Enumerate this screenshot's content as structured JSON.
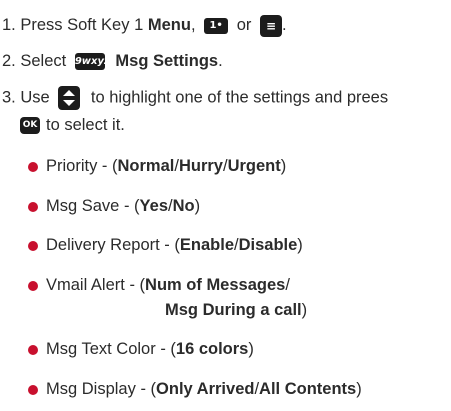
{
  "step1": {
    "num": "1.",
    "text": "Press Soft Key 1",
    "menu": "Menu",
    "comma": ",",
    "or": "or",
    "period": ".",
    "key_softkey_label": "1•",
    "key_menu_label": "≡"
  },
  "step2": {
    "num": "2.",
    "text": "Select",
    "key_label": "9wxyz",
    "target": "Msg Settings",
    "period": "."
  },
  "step3": {
    "num": "3.",
    "text_a": "Use",
    "text_b": "to highlight one of the settings and prees",
    "key_ok_label": "OK",
    "text_c": "to select it."
  },
  "settings": [
    {
      "name": "Priority",
      "sep": " - (",
      "options": [
        {
          "label": "Normal",
          "bold": true
        },
        {
          "label": "/",
          "bold": false
        },
        {
          "label": "Hurry",
          "bold": true
        },
        {
          "label": "/",
          "bold": false
        },
        {
          "label": "Urgent",
          "bold": true
        },
        {
          "label": ")",
          "bold": false
        }
      ]
    },
    {
      "name": "Msg Save",
      "sep": " - (",
      "options": [
        {
          "label": "Yes",
          "bold": true
        },
        {
          "label": "/",
          "bold": false
        },
        {
          "label": "No",
          "bold": true
        },
        {
          "label": ")",
          "bold": false
        }
      ]
    },
    {
      "name": "Delivery Report",
      "sep": " - (",
      "options": [
        {
          "label": "Enable",
          "bold": true
        },
        {
          "label": "/",
          "bold": false
        },
        {
          "label": "Disable",
          "bold": true
        },
        {
          "label": ")",
          "bold": false
        }
      ]
    },
    {
      "name": "Vmail Alert",
      "sep": " - (",
      "options": [
        {
          "label": "Num of Messages",
          "bold": true
        },
        {
          "label": "/",
          "bold": false
        }
      ],
      "continuation": "Msg During a call",
      "continuation_end": ")"
    },
    {
      "name": "Msg Text Color",
      "sep": " - (",
      "options": [
        {
          "label": "16 colors",
          "bold": true
        },
        {
          "label": ")",
          "bold": false
        }
      ]
    },
    {
      "name": "Msg Display",
      "sep": " - (",
      "options": [
        {
          "label": "Only Arrived",
          "bold": true
        },
        {
          "label": "/",
          "bold": false
        },
        {
          "label": "All Contents",
          "bold": true
        },
        {
          "label": ")",
          "bold": false
        }
      ]
    }
  ],
  "colors": {
    "bullet": "#c8102e",
    "text": "#2b2b2b",
    "key_bg": "#1c1c1c"
  }
}
